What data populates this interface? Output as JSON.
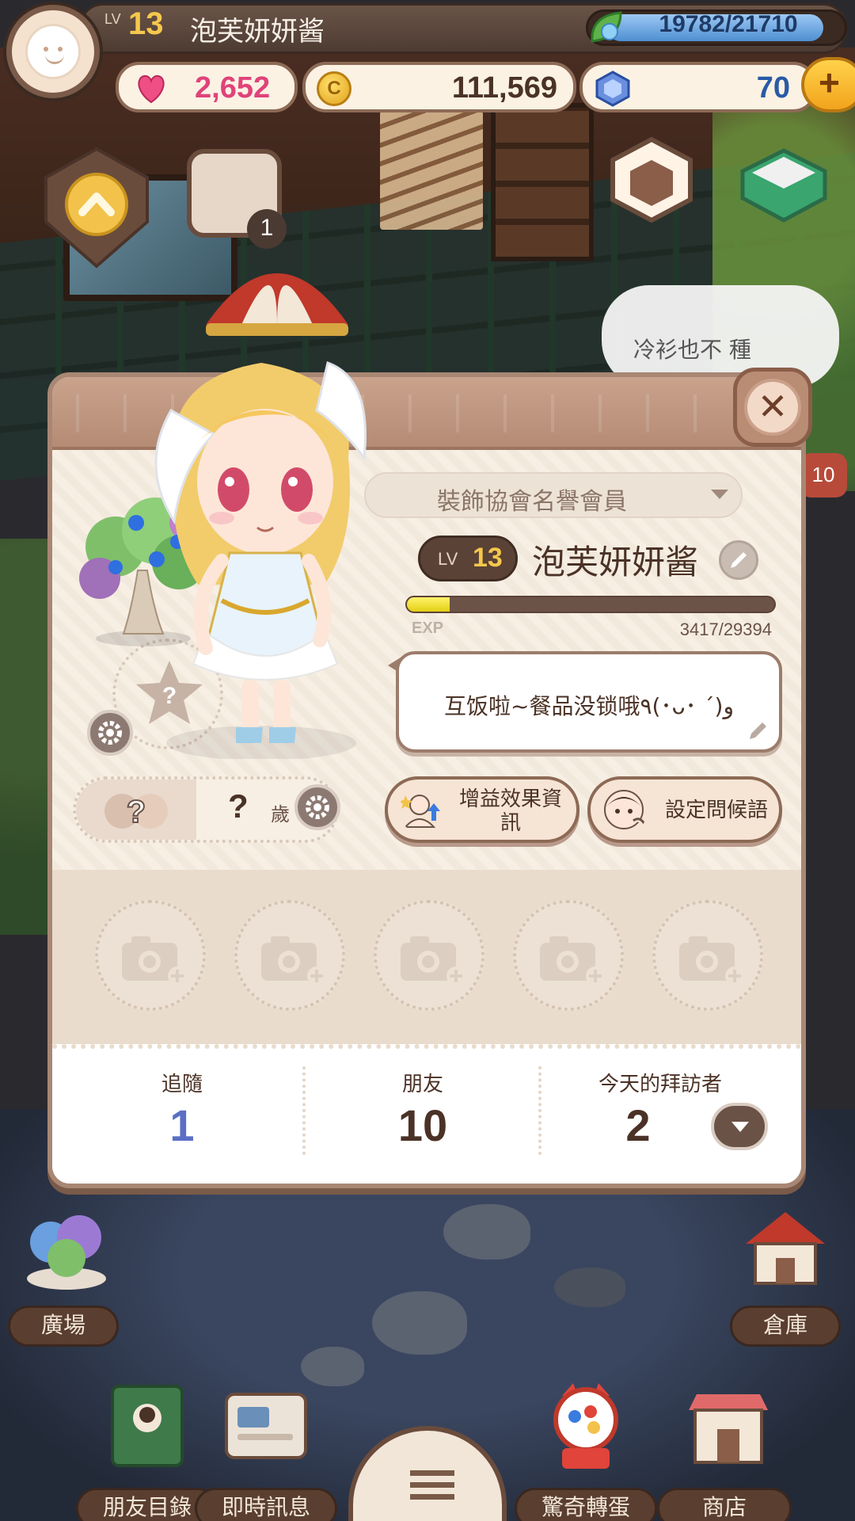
{
  "hud": {
    "level_label": "LV",
    "level": "13",
    "player_name": "泡芙妍妍酱",
    "energy_text": "19782/21710",
    "energy_fraction": 0.911,
    "hearts": "2,652",
    "coins": "111,569",
    "coin_symbol": "C",
    "gems": "70",
    "plus_label": "+"
  },
  "background": {
    "speech_text": "冷衫也不  種",
    "room_badge": "1",
    "side_badge": "10"
  },
  "profile": {
    "close_label": "✕",
    "title_badge": "裝飾協會名譽會員",
    "level_label": "LV",
    "level": "13",
    "name": "泡芙妍妍酱",
    "exp_label": "EXP",
    "exp_text": "3417/29394",
    "exp_fraction": 0.116,
    "greeting": "互饭啦~餐品没锁哦٩(･ᴗ･ ´)و",
    "pet_slot_mark": "?",
    "gender_mark": "?",
    "age_value": "?",
    "age_unit": "歲",
    "buttons": {
      "buff_info": "增益效果資訊",
      "set_greeting": "設定問候語"
    },
    "stats": {
      "follow_label": "追隨",
      "follow_value": "1",
      "friends_label": "朋友",
      "friends_value": "10",
      "visitors_label": "今天的拜訪者",
      "visitors_value": "2"
    }
  },
  "nav": {
    "plaza": "廣場",
    "warehouse": "倉庫",
    "friend_list": "朋友目錄",
    "messages": "即時訊息",
    "gacha": "驚奇轉蛋",
    "shop": "商店"
  },
  "colors": {
    "follow_value": "#5a6fc4",
    "friends_value": "#4b3226",
    "visitors_value": "#4b3226",
    "hearts": "#e0437a",
    "coins": "#4b3226",
    "gems": "#2a5aa6"
  }
}
